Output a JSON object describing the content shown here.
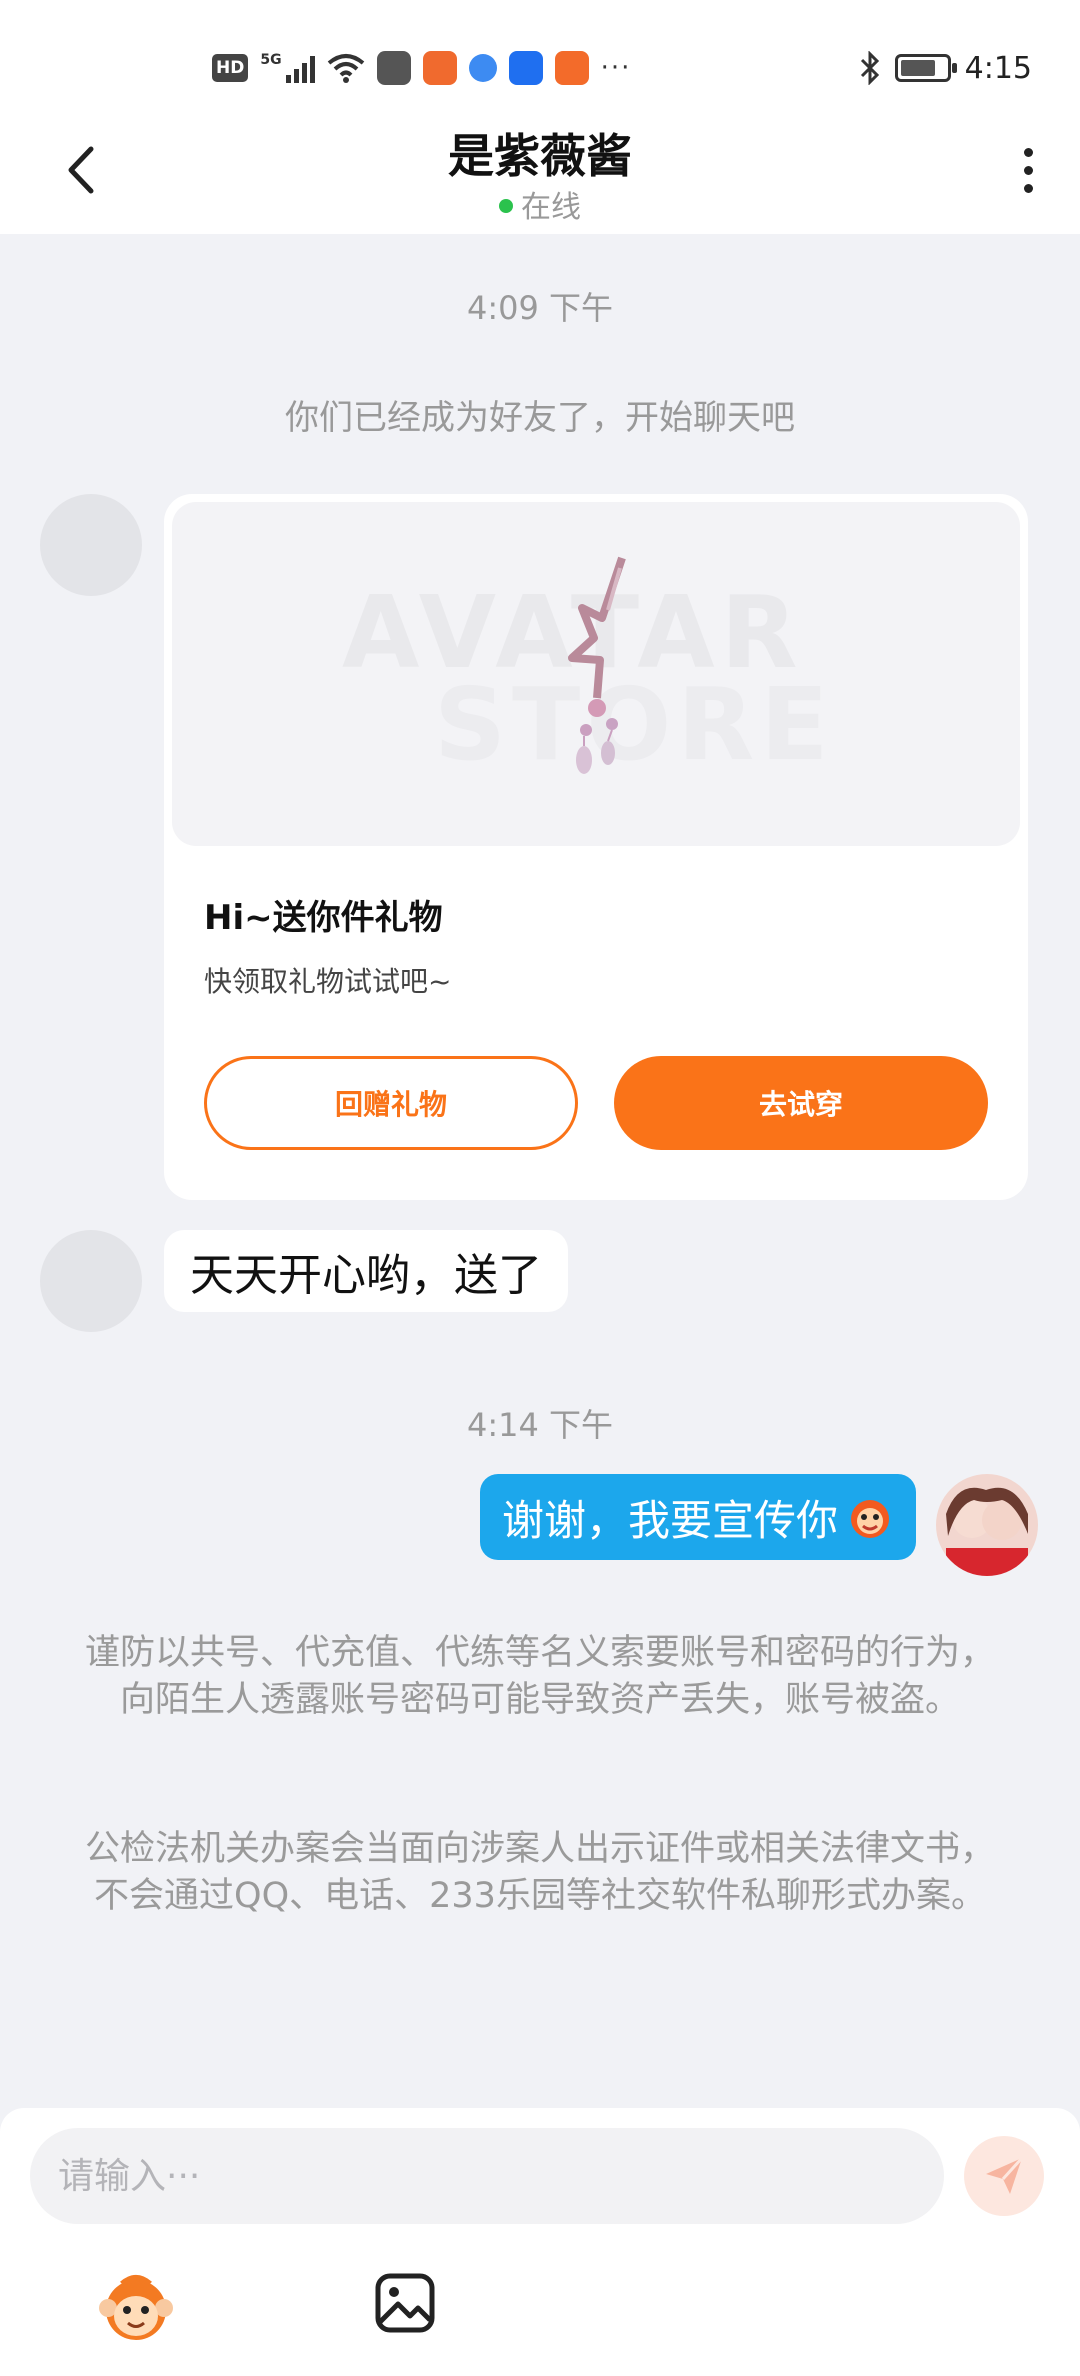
{
  "status_bar": {
    "network_badge": "HD",
    "network_type": "5G",
    "time": "4:15",
    "overflow": "···"
  },
  "header": {
    "title": "是紫薇酱",
    "status": "在线",
    "back_icon": "chevron-left-icon",
    "more_icon": "more-vertical-icon"
  },
  "chat": {
    "timestamp_1": "4:09 下午",
    "system_note": "你们已经成为好友了，开始聊天吧",
    "gift_card": {
      "watermark_line1": "AVATAR",
      "watermark_line2": "STORE",
      "title": "Hi~送你件礼物",
      "subtitle": "快领取礼物试试吧~",
      "return_button": "回赠礼物",
      "try_button": "去试穿"
    },
    "incoming_message": "天天开心哟，送了",
    "timestamp_2": "4:14 下午",
    "outgoing_message": "谢谢，我要宣传你",
    "warning_1": "谨防以共号、代充值、代练等名义索要账号和密码的行为，向陌生人透露账号密码可能导致资产丢失，账号被盗。",
    "warning_2": "公检法机关办案会当面向涉案人出示证件或相关法律文书，不会通过QQ、电话、233乐园等社交软件私聊形式办案。"
  },
  "input": {
    "placeholder": "请输入···",
    "send_icon": "send-icon",
    "emoji_icon": "monkey-emoji-icon",
    "image_icon": "image-icon"
  },
  "colors": {
    "accent_orange": "#fa7318",
    "bubble_blue": "#1ca7ec",
    "online_green": "#2bc24d",
    "background": "#f1f2f6"
  }
}
